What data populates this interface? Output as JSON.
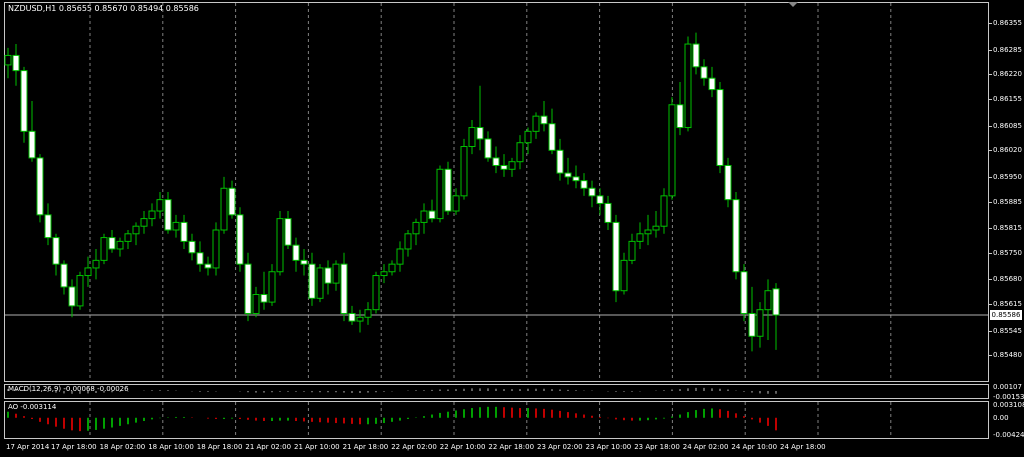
{
  "chart_data": [
    {
      "type": "candlestick",
      "title": "NZDUSD,H1  0.85655 0.85670 0.85494 0.85586",
      "symbol": "NZDUSD,H1",
      "ohlc_header": "0.85655 0.85670 0.85494 0.85586",
      "last_price": "0.85586",
      "ylim": [
        0.8542,
        0.86395
      ],
      "yticks": [
        "0.86355",
        "0.86285",
        "0.86220",
        "0.86155",
        "0.86085",
        "0.86020",
        "0.85950",
        "0.85885",
        "0.85815",
        "0.85750",
        "0.85680",
        "0.85615",
        "0.85545",
        "0.85480"
      ],
      "candles": [
        [
          0.86245,
          0.8629,
          0.8621,
          0.8627
        ],
        [
          0.8627,
          0.863,
          0.8619,
          0.8623
        ],
        [
          0.8623,
          0.8624,
          0.8604,
          0.8607
        ],
        [
          0.8607,
          0.8615,
          0.8599,
          0.86
        ],
        [
          0.86,
          0.8601,
          0.8583,
          0.8585
        ],
        [
          0.8585,
          0.8588,
          0.8577,
          0.8579
        ],
        [
          0.8579,
          0.858,
          0.8569,
          0.8572
        ],
        [
          0.8572,
          0.8573,
          0.8564,
          0.8566
        ],
        [
          0.8566,
          0.8568,
          0.8558,
          0.8561
        ],
        [
          0.8561,
          0.857,
          0.856,
          0.8569
        ],
        [
          0.8569,
          0.8574,
          0.8566,
          0.8571
        ],
        [
          0.8571,
          0.8576,
          0.8568,
          0.8573
        ],
        [
          0.8573,
          0.858,
          0.8572,
          0.8579
        ],
        [
          0.8579,
          0.8581,
          0.8575,
          0.8576
        ],
        [
          0.8576,
          0.8579,
          0.8574,
          0.8578
        ],
        [
          0.8578,
          0.8581,
          0.8576,
          0.858
        ],
        [
          0.858,
          0.8583,
          0.8577,
          0.8582
        ],
        [
          0.8582,
          0.8586,
          0.858,
          0.8584
        ],
        [
          0.8584,
          0.8588,
          0.8582,
          0.8586
        ],
        [
          0.8586,
          0.8591,
          0.8584,
          0.8589
        ],
        [
          0.8589,
          0.8591,
          0.858,
          0.8581
        ],
        [
          0.8581,
          0.8585,
          0.8579,
          0.8583
        ],
        [
          0.8583,
          0.8585,
          0.8576,
          0.8578
        ],
        [
          0.8578,
          0.858,
          0.8573,
          0.8575
        ],
        [
          0.8575,
          0.8578,
          0.857,
          0.8572
        ],
        [
          0.8572,
          0.8574,
          0.8569,
          0.8571
        ],
        [
          0.8571,
          0.8583,
          0.8569,
          0.8581
        ],
        [
          0.8581,
          0.8595,
          0.858,
          0.8592
        ],
        [
          0.8592,
          0.8594,
          0.8584,
          0.8585
        ],
        [
          0.8585,
          0.8587,
          0.857,
          0.8572
        ],
        [
          0.8572,
          0.8575,
          0.8557,
          0.8559
        ],
        [
          0.8559,
          0.8566,
          0.8558,
          0.8564
        ],
        [
          0.8564,
          0.857,
          0.856,
          0.8562
        ],
        [
          0.8562,
          0.8572,
          0.8561,
          0.857
        ],
        [
          0.857,
          0.8586,
          0.8569,
          0.8584
        ],
        [
          0.8584,
          0.8586,
          0.8576,
          0.8577
        ],
        [
          0.8577,
          0.8579,
          0.857,
          0.8573
        ],
        [
          0.8573,
          0.8576,
          0.8569,
          0.8572
        ],
        [
          0.8572,
          0.8575,
          0.8561,
          0.8563
        ],
        [
          0.8563,
          0.8572,
          0.8562,
          0.8571
        ],
        [
          0.8571,
          0.8573,
          0.8564,
          0.8567
        ],
        [
          0.8567,
          0.8573,
          0.8565,
          0.8572
        ],
        [
          0.8572,
          0.8575,
          0.8557,
          0.8559
        ],
        [
          0.8559,
          0.8561,
          0.8556,
          0.8557
        ],
        [
          0.8557,
          0.856,
          0.8554,
          0.8558
        ],
        [
          0.8558,
          0.8562,
          0.8556,
          0.856
        ],
        [
          0.856,
          0.857,
          0.8559,
          0.8569
        ],
        [
          0.8569,
          0.8572,
          0.8567,
          0.857
        ],
        [
          0.857,
          0.8573,
          0.8569,
          0.8572
        ],
        [
          0.8572,
          0.8578,
          0.857,
          0.8576
        ],
        [
          0.8576,
          0.8581,
          0.8574,
          0.858
        ],
        [
          0.858,
          0.8584,
          0.8577,
          0.8583
        ],
        [
          0.8583,
          0.8588,
          0.858,
          0.8586
        ],
        [
          0.8586,
          0.8589,
          0.8583,
          0.8584
        ],
        [
          0.8584,
          0.8598,
          0.8583,
          0.8597
        ],
        [
          0.8597,
          0.8599,
          0.8585,
          0.8586
        ],
        [
          0.8586,
          0.8592,
          0.8585,
          0.859
        ],
        [
          0.859,
          0.8605,
          0.8589,
          0.8603
        ],
        [
          0.8603,
          0.861,
          0.8601,
          0.8608
        ],
        [
          0.8608,
          0.8619,
          0.8602,
          0.8605
        ],
        [
          0.8605,
          0.8607,
          0.8599,
          0.86
        ],
        [
          0.86,
          0.8603,
          0.8596,
          0.8598
        ],
        [
          0.8598,
          0.8601,
          0.8595,
          0.8597
        ],
        [
          0.8597,
          0.86,
          0.8595,
          0.8599
        ],
        [
          0.8599,
          0.8606,
          0.8597,
          0.8604
        ],
        [
          0.8604,
          0.8608,
          0.8601,
          0.8607
        ],
        [
          0.8607,
          0.8612,
          0.8605,
          0.8611
        ],
        [
          0.8611,
          0.8615,
          0.8607,
          0.8609
        ],
        [
          0.8609,
          0.8613,
          0.8601,
          0.8602
        ],
        [
          0.8602,
          0.8605,
          0.8594,
          0.8596
        ],
        [
          0.8596,
          0.86,
          0.8593,
          0.8595
        ],
        [
          0.8595,
          0.8598,
          0.8592,
          0.8594
        ],
        [
          0.8594,
          0.8596,
          0.859,
          0.8592
        ],
        [
          0.8592,
          0.8594,
          0.8587,
          0.859
        ],
        [
          0.859,
          0.8592,
          0.8585,
          0.8588
        ],
        [
          0.8588,
          0.859,
          0.8581,
          0.8583
        ],
        [
          0.8583,
          0.8585,
          0.8562,
          0.8565
        ],
        [
          0.8565,
          0.8575,
          0.8564,
          0.8573
        ],
        [
          0.8573,
          0.858,
          0.8572,
          0.8578
        ],
        [
          0.8578,
          0.8583,
          0.8576,
          0.858
        ],
        [
          0.858,
          0.8585,
          0.8577,
          0.8581
        ],
        [
          0.8581,
          0.8586,
          0.8579,
          0.8582
        ],
        [
          0.8582,
          0.8592,
          0.858,
          0.859
        ],
        [
          0.859,
          0.8616,
          0.8589,
          0.8614
        ],
        [
          0.8614,
          0.862,
          0.8606,
          0.8608
        ],
        [
          0.8608,
          0.8632,
          0.8607,
          0.863
        ],
        [
          0.863,
          0.8633,
          0.8622,
          0.8624
        ],
        [
          0.8624,
          0.8626,
          0.8619,
          0.8621
        ],
        [
          0.8621,
          0.8624,
          0.8616,
          0.8618
        ],
        [
          0.8618,
          0.862,
          0.8596,
          0.8598
        ],
        [
          0.8598,
          0.86,
          0.8587,
          0.8589
        ],
        [
          0.8589,
          0.8591,
          0.8568,
          0.857
        ],
        [
          0.857,
          0.8572,
          0.8557,
          0.8559
        ],
        [
          0.8559,
          0.8566,
          0.8549,
          0.8553
        ],
        [
          0.8553,
          0.8562,
          0.855,
          0.856
        ],
        [
          0.856,
          0.8568,
          0.8552,
          0.8565
        ],
        [
          0.85655,
          0.8567,
          0.85494,
          0.85586
        ]
      ]
    },
    {
      "type": "histogram",
      "title": "MACD(12,26,9) -0.00068 -0.00026",
      "yticks": [
        "0.00107",
        "-0.00153"
      ],
      "ylim": [
        -0.0018,
        0.0013
      ],
      "values": [
        0.0005,
        0.0006,
        0.0004,
        0.0002,
        0.0,
        -0.0002,
        -0.0004,
        -0.0006,
        -0.0007,
        -0.0007,
        -0.0006,
        -0.0005,
        -0.0004,
        -0.0003,
        -0.0002,
        -0.0001,
        0.0,
        0.0001,
        0.0002,
        0.0002,
        0.0002,
        0.0001,
        0.0,
        -0.0001,
        -0.0002,
        -0.0002,
        -0.0001,
        0.0,
        0.0,
        -0.0001,
        -0.0003,
        -0.0004,
        -0.0004,
        -0.0003,
        -0.0002,
        -0.0002,
        -0.0002,
        -0.0002,
        -0.0003,
        -0.0003,
        -0.0003,
        -0.0003,
        -0.0004,
        -0.0005,
        -0.0005,
        -0.0004,
        -0.0003,
        -0.0002,
        -0.0001,
        0.0,
        0.0001,
        0.0002,
        0.0002,
        0.0003,
        0.0004,
        0.0004,
        0.0005,
        0.0006,
        0.0007,
        0.0007,
        0.0007,
        0.0006,
        0.0005,
        0.0005,
        0.0005,
        0.0006,
        0.0006,
        0.0006,
        0.0005,
        0.0004,
        0.0003,
        0.0002,
        0.0001,
        0.0001,
        0.0,
        -0.0001,
        -0.0002,
        -0.0002,
        -0.0002,
        -0.0001,
        0.0,
        0.0001,
        0.0002,
        0.0004,
        0.0005,
        0.0007,
        0.0008,
        0.0008,
        0.0007,
        0.0006,
        0.0004,
        0.0001,
        -0.0002,
        -0.0004,
        -0.0006,
        -0.0007,
        -0.0007
      ]
    },
    {
      "type": "histogram",
      "title": "AO -0.003114",
      "yticks": [
        "0.003108",
        "0.00",
        "-0.004243"
      ],
      "ylim": [
        -0.0045,
        0.0034
      ],
      "values": [
        0.0015,
        0.001,
        0.0004,
        -0.0003,
        -0.001,
        -0.0016,
        -0.0022,
        -0.0027,
        -0.0031,
        -0.0033,
        -0.0032,
        -0.003,
        -0.0027,
        -0.0024,
        -0.002,
        -0.0016,
        -0.0012,
        -0.0008,
        -0.0004,
        -0.0001,
        0.0001,
        0.0002,
        0.0002,
        0.0001,
        0.0,
        -0.0002,
        -0.0003,
        -0.0003,
        -0.0002,
        -0.0003,
        -0.0005,
        -0.0007,
        -0.0008,
        -0.0008,
        -0.0007,
        -0.0007,
        -0.0008,
        -0.0009,
        -0.001,
        -0.0011,
        -0.0012,
        -0.0013,
        -0.0014,
        -0.0015,
        -0.0016,
        -0.0016,
        -0.0015,
        -0.0013,
        -0.001,
        -0.0007,
        -0.0003,
        0.0001,
        0.0004,
        0.0008,
        0.0012,
        0.0015,
        0.0018,
        0.0021,
        0.0024,
        0.0026,
        0.0027,
        0.0027,
        0.0026,
        0.0025,
        0.0024,
        0.0024,
        0.0023,
        0.0022,
        0.002,
        0.0017,
        0.0014,
        0.0011,
        0.0008,
        0.0005,
        0.0002,
        -0.0001,
        -0.0004,
        -0.0006,
        -0.0007,
        -0.0007,
        -0.0006,
        -0.0004,
        -0.0002,
        0.0003,
        0.0008,
        0.0014,
        0.0019,
        0.0022,
        0.0023,
        0.0021,
        0.0017,
        0.0011,
        0.0004,
        -0.0004,
        -0.0012,
        -0.002,
        -0.0031
      ]
    }
  ],
  "time_axis": [
    "17 Apr 2014",
    "17 Apr 18:00",
    "18 Apr 02:00",
    "18 Apr 10:00",
    "18 Apr 18:00",
    "21 Apr 02:00",
    "21 Apr 10:00",
    "21 Apr 18:00",
    "22 Apr 02:00",
    "22 Apr 10:00",
    "22 Apr 18:00",
    "23 Apr 02:00",
    "23 Apr 10:00",
    "23 Apr 18:00",
    "24 Apr 02:00",
    "24 Apr 10:00",
    "24 Apr 18:00"
  ],
  "colors": {
    "background": "#000000",
    "bull_body": "#000000",
    "bear_body": "#ffffff",
    "wick": "#00c000",
    "grid": "#808080",
    "ao_up": "#00a000",
    "ao_down": "#c00000",
    "axis_text": "#ffffff"
  }
}
